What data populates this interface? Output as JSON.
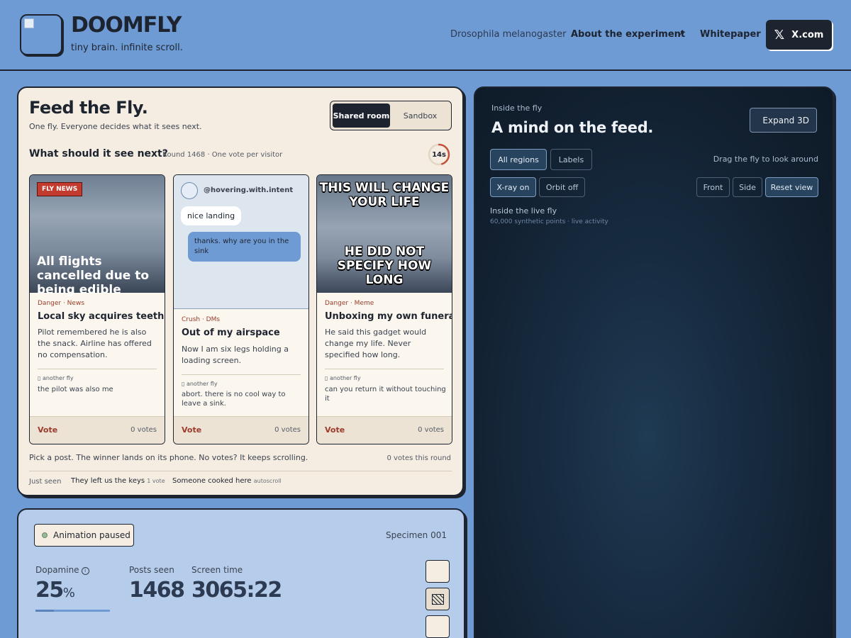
{
  "header": {
    "brand": "DOOMFLY",
    "tagline": "tiny brain. infinite scroll.",
    "nav": {
      "species": "Drosophila melanogaster",
      "about": "About the experiment",
      "about_arrow": "↗",
      "whitepaper": "Whitepaper",
      "x_label": "X.com",
      "x_logo": "𝕏"
    }
  },
  "feed": {
    "title": "Feed the Fly.",
    "subtitle": "One fly. Everyone decides what it sees next.",
    "modes": [
      "Shared room",
      "Sandbox"
    ],
    "active_mode": "Shared room",
    "question": "What should it see next?",
    "round_info": "Round 1468 · One vote per visitor",
    "timer": "14s",
    "timer_fraction": 0.45,
    "cards": [
      {
        "image_badge": "FLY NEWS",
        "image_caption": "All flights cancelled due to being edible",
        "category": "Danger · News",
        "title": "Local sky acquires teeth",
        "body": "Pilot remembered he is also the snack. Airline has offered no compensation.",
        "reply_author": "▯ another fly",
        "reply": "the pilot was also me",
        "vote_label": "Vote",
        "votes": "0 votes"
      },
      {
        "chat_handle": "@hovering.with.intent",
        "chat_in": "nice landing",
        "chat_out": "thanks. why are you in the sink",
        "category": "Crush · DMs",
        "title": "Out of my airspace",
        "body": "Now I am six legs holding a loading screen.",
        "reply_author": "▯ another fly",
        "reply": "abort. there is no cool way to leave a sink.",
        "vote_label": "Vote",
        "votes": "0 votes"
      },
      {
        "meme_top": "THIS WILL CHANGE YOUR LIFE",
        "meme_bottom": "HE DID NOT SPECIFY HOW LONG",
        "category": "Danger · Meme",
        "title": "Unboxing my own funeral",
        "body": "He said this gadget would change my life. Never specified how long.",
        "reply_author": "▯ another fly",
        "reply": "can you return it without touching it",
        "vote_label": "Vote",
        "votes": "0 votes"
      }
    ],
    "pick_text": "Pick a post. The winner lands on its phone. No votes? It keeps scrolling.",
    "round_votes": "0 votes this round",
    "just_seen_label": "Just seen",
    "just_seen": [
      {
        "title": "They left us the keys",
        "meta": "1 vote"
      },
      {
        "title": "Someone cooked here",
        "meta": "autoscroll"
      }
    ]
  },
  "stats": {
    "animation": "Animation paused",
    "specimen": "Specimen 001",
    "dopamine_label": "Dopamine",
    "info_icon": "i",
    "dopamine_value": "25",
    "dopamine_unit": "%",
    "dopamine_fraction": 0.25,
    "posts_label": "Posts seen",
    "posts_value": "1468",
    "screen_label": "Screen time",
    "screen_value": "3065:22"
  },
  "mind": {
    "kicker": "Inside the fly",
    "title": "A mind on the feed.",
    "expand": "Expand 3D",
    "region_chips": [
      "All regions",
      "Labels"
    ],
    "drag_hint": "Drag the fly to look around",
    "xray": "X-ray on",
    "orbit": "Orbit off",
    "views": [
      "Front",
      "Side",
      "Reset view"
    ],
    "live_title": "Inside the live fly",
    "live_sub": "60,000 synthetic points · live activity"
  },
  "colors": {
    "page_bg": "#6f9bd4",
    "ink": "#1d2430",
    "paper": "#f5ede1",
    "accent_red": "#9b3a2a",
    "mind_bg": "#111f2e"
  }
}
